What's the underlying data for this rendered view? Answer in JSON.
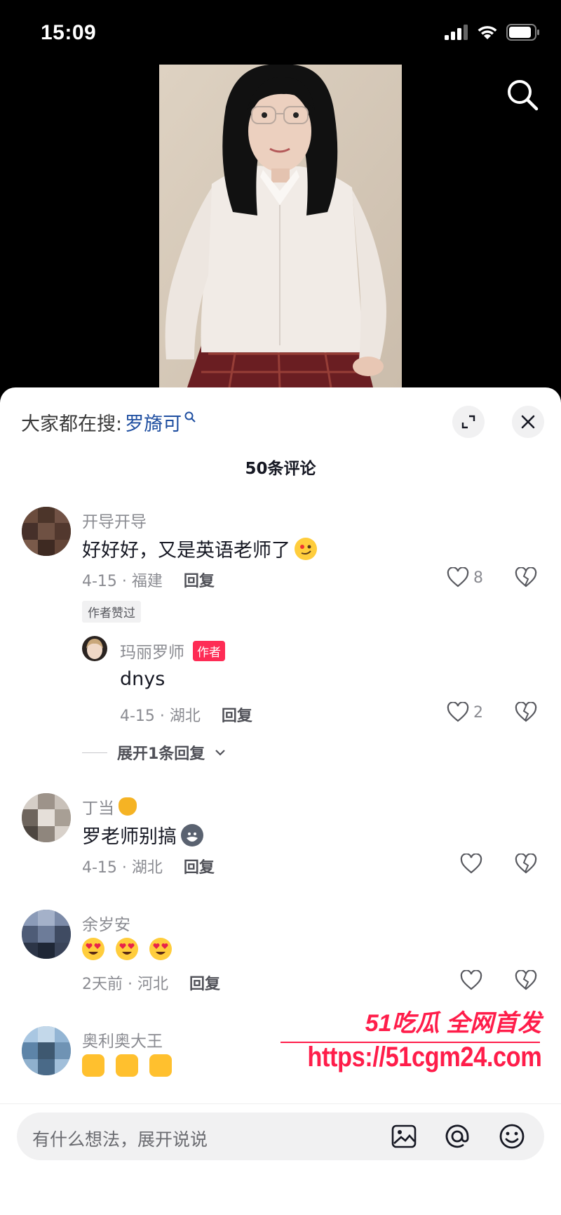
{
  "status_bar": {
    "time": "15:09"
  },
  "sheet": {
    "suggest_prefix": "大家都在搜:",
    "suggest_term": "罗旖可",
    "comment_count": "50条评论"
  },
  "comments": [
    {
      "name": "开导开导",
      "text": "好好好，又是英语老师了",
      "meta": "4-15 · 福建",
      "reply_label": "回复",
      "likes": "8",
      "author_liked": "作者赞过"
    },
    {
      "name": "玛丽罗师",
      "badge": "作者",
      "text": "dnys",
      "meta": "4-15 · 湖北",
      "reply_label": "回复",
      "likes": "2",
      "expand_label": "展开1条回复"
    },
    {
      "name": "丁当",
      "text": "罗老师别搞",
      "meta": "4-15 · 湖北",
      "reply_label": "回复"
    },
    {
      "name": "余岁安",
      "meta": "2天前 · 河北",
      "reply_label": "回复"
    },
    {
      "name": "奥利奥大王"
    }
  ],
  "watermark": {
    "title": "51吃瓜 全网首发",
    "url": "https://51cgm24.com"
  },
  "input": {
    "placeholder": "有什么想法，展开说说"
  },
  "colors": {
    "accent": "#fe2c55",
    "link": "#1e4ea0",
    "watermark": "#ff1d4a"
  }
}
